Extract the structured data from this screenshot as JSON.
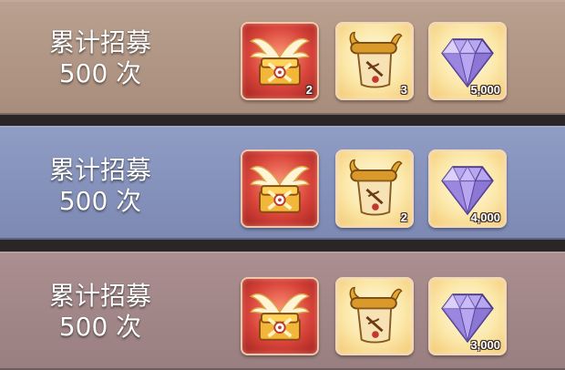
{
  "rows": [
    {
      "line1": "累计招募",
      "line2": "500 次",
      "rewards": [
        {
          "icon": "winged-chest-icon",
          "count": "2"
        },
        {
          "icon": "scroll-icon",
          "count": "3"
        },
        {
          "icon": "diamond-icon",
          "count": "5,000"
        }
      ]
    },
    {
      "line1": "累计招募",
      "line2": "500 次",
      "rewards": [
        {
          "icon": "winged-chest-icon",
          "count": ""
        },
        {
          "icon": "scroll-icon",
          "count": "2"
        },
        {
          "icon": "diamond-icon",
          "count": "4,000"
        }
      ]
    },
    {
      "line1": "累计招募",
      "line2": "500 次",
      "rewards": [
        {
          "icon": "winged-chest-icon",
          "count": ""
        },
        {
          "icon": "scroll-icon",
          "count": ""
        },
        {
          "icon": "diamond-icon",
          "count": "3,000"
        }
      ]
    }
  ],
  "colors": {
    "row1": "#b9a08f",
    "row2": "#8f9cc4",
    "row3": "#ab8f90",
    "chest_bg": "#d8443a",
    "item_bg": "#fbe7a8"
  }
}
